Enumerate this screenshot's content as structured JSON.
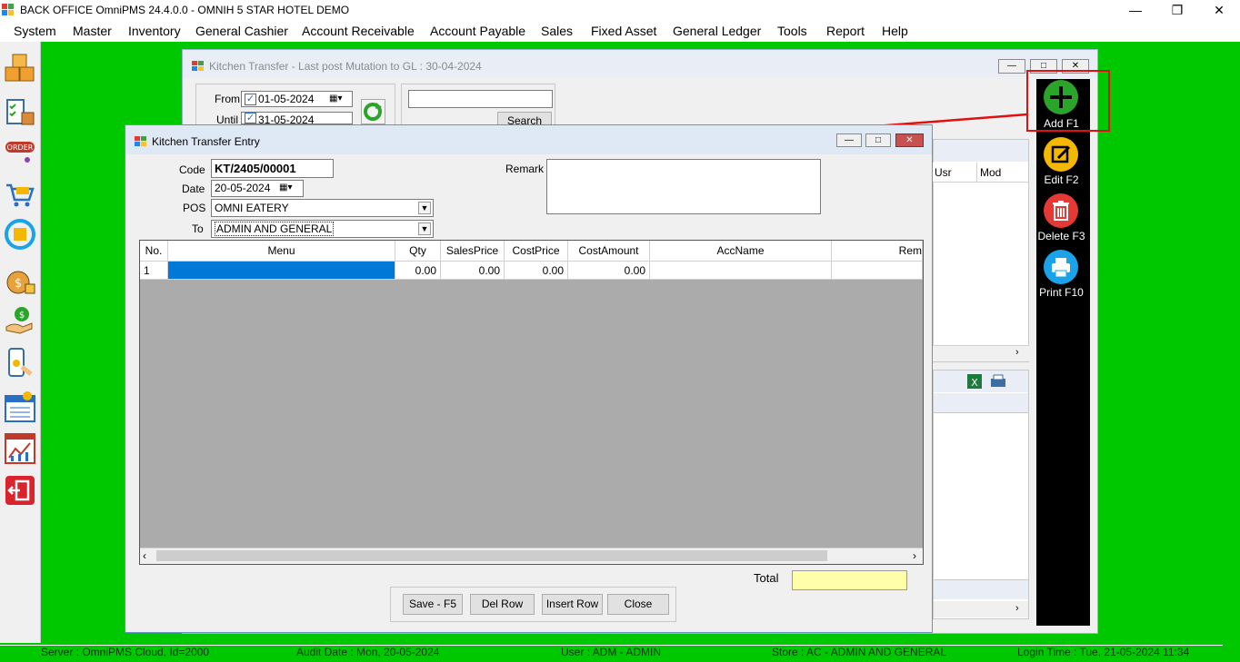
{
  "app": {
    "title": "BACK OFFICE OmniPMS 24.4.0.0 - OMNIH 5 STAR HOTEL DEMO"
  },
  "menu": [
    "System",
    "Master",
    "Inventory",
    "General Cashier",
    "Account Receivable",
    "Account Payable",
    "Sales",
    "Fixed Asset",
    "General Ledger",
    "Tools",
    "Report",
    "Help"
  ],
  "parent_window": {
    "title": "Kitchen Transfer - Last post Mutation to GL : 30-04-2024",
    "from_label": "From",
    "from_date": "01-05-2024",
    "until_label": "Until",
    "until_date": "31-05-2024",
    "search_value": "",
    "search_button": "Search",
    "col_usr": "Usr",
    "col_mod": "Mod"
  },
  "toolbar": {
    "add": "Add F1",
    "edit": "Edit F2",
    "delete": "Delete F3",
    "print": "Print F10",
    "colors": {
      "add": "#2aa52a",
      "edit": "#f5b800",
      "delete": "#e53935",
      "print": "#1aa3e8"
    }
  },
  "dialog": {
    "title": "Kitchen Transfer Entry",
    "code_label": "Code",
    "code_value": "KT/2405/00001",
    "date_label": "Date",
    "date_value": "20-05-2024",
    "pos_label": "POS",
    "pos_value": "OMNI EATERY",
    "to_label": "To",
    "to_value": "ADMIN AND GENERAL",
    "remark_label": "Remark",
    "remark_value": "",
    "grid": {
      "columns": [
        "No.",
        "Menu",
        "Qty",
        "SalesPrice",
        "CostPrice",
        "CostAmount",
        "AccName",
        "Rem"
      ],
      "rows": [
        [
          "1",
          "",
          "0.00",
          "0.00",
          "0.00",
          "0.00",
          "",
          ""
        ]
      ]
    },
    "total_label": "Total",
    "total_value": "",
    "buttons": {
      "save": "Save - F5",
      "del_row": "Del Row",
      "insert_row": "Insert Row",
      "close": "Close"
    }
  },
  "status": {
    "server": "Server : OmniPMS Cloud, Id=2000",
    "audit": "Audit Date : Mon, 20-05-2024",
    "user": "User : ADM - ADMIN",
    "store": "Store : AC - ADMIN AND GENERAL",
    "login": "Login Time : Tue, 21-05-2024 11:34"
  }
}
